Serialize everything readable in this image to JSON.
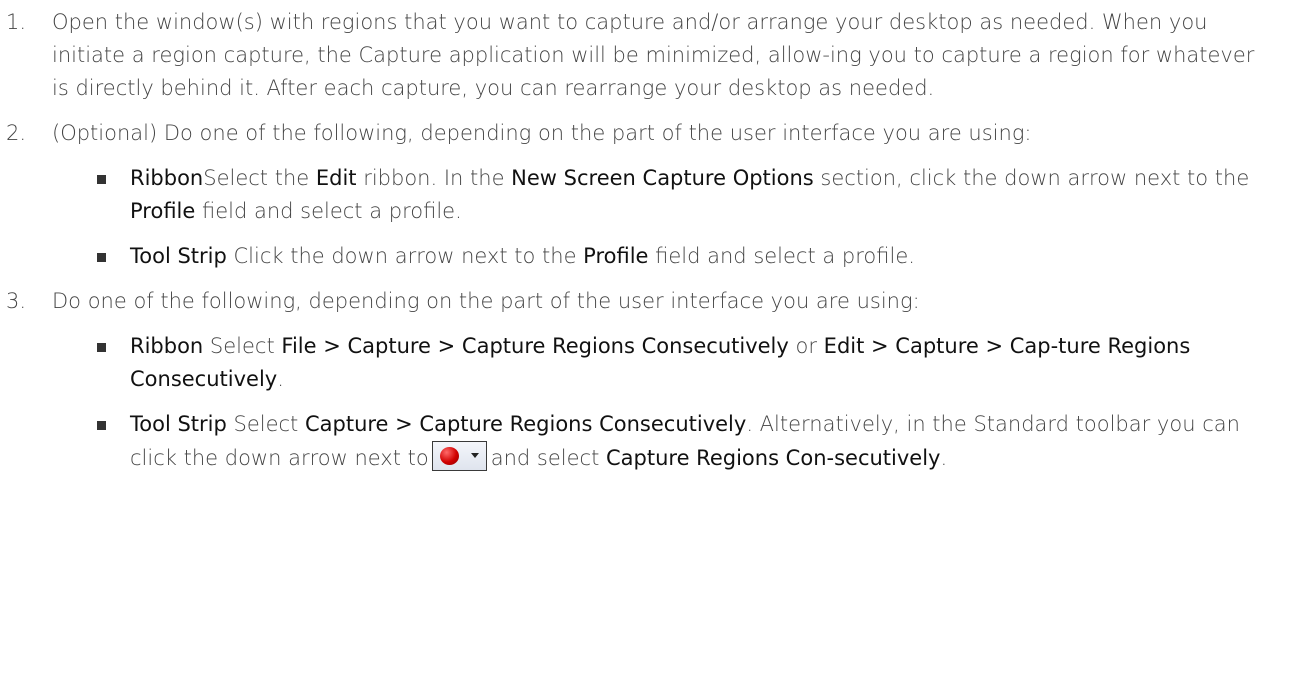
{
  "steps": [
    {
      "num": "1.",
      "text": "Open the window(s) with regions that you want to capture and/or arrange your desktop as needed. When you initiate a region capture, the Capture application will be minimized, allow-ing you to capture a region for whatever is directly behind it. After each capture, you can rearrange your desktop as needed."
    },
    {
      "num": "2.",
      "text": "(Optional) Do one of the following, depending on the part of the user interface you are using:",
      "items": [
        {
          "label": "Ribbon",
          "t1": "Select the ",
          "b1": "Edit",
          "t2": " ribbon. In the ",
          "b2": "New Screen Capture Options",
          "t3": " section, click the down arrow next to the ",
          "b3": "Profile",
          "t4": " field and select a profile."
        },
        {
          "label": "Tool Strip",
          "t1": " Click the down arrow next to the ",
          "b1": "Profile",
          "t2": " field and select a profile."
        }
      ]
    },
    {
      "num": "3.",
      "text": " Do one of the following, depending on the part of the user interface you are using:",
      "items": [
        {
          "label": "Ribbon",
          "t1": " Select ",
          "b1": "File > Capture > Capture Regions Consecutively",
          "t2": " or ",
          "b2": "Edit > Capture > Cap-ture Regions Consecutively",
          "t3": "."
        },
        {
          "label": "Tool Strip",
          "t1": " Select ",
          "b1": "Capture > Capture Regions Consecutively",
          "t2": ". Alternatively, in the Standard toolbar you can click the down arrow next to",
          "icon": "record-dropdown-icon",
          "t3": "and select ",
          "b2": "Capture Regions Con-secutively",
          "t4": "."
        }
      ]
    }
  ]
}
